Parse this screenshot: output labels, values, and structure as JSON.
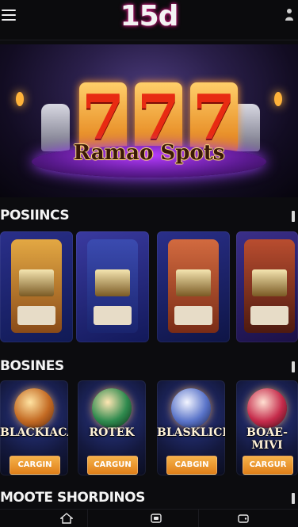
{
  "header": {
    "logo": "15d"
  },
  "hero": {
    "title": "Ramao Spots"
  },
  "sections": {
    "positions": {
      "title": "POSIINCS"
    },
    "bosines": {
      "title": "BOSINES"
    },
    "more": {
      "title": "MOOTE SHORDINOS"
    }
  },
  "tables": {
    "items": [
      {
        "label": "BLACKIACAR",
        "button": "CARGIN"
      },
      {
        "label": "ROTEK",
        "button": "CARGUN"
      },
      {
        "label": "BLASKLICK",
        "button": "CABGIN"
      },
      {
        "label": "BOAE-MIVI",
        "button": "CARGUR"
      }
    ]
  },
  "colors": {
    "background": "#0c0c0f",
    "accent_orange": "#f6b24a",
    "logo_glow": "#c41a7a"
  },
  "icons": [
    "menu-icon",
    "user-icon",
    "home-icon",
    "slot-icon",
    "wallet-icon"
  ]
}
